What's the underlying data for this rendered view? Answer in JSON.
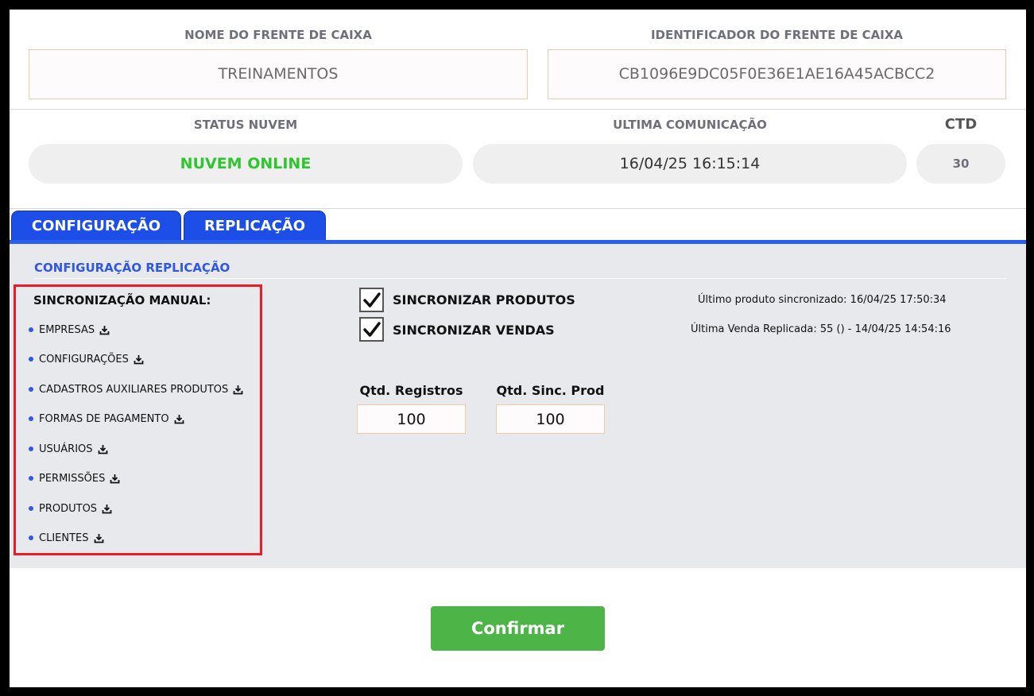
{
  "header": {
    "nome_label": "NOME DO FRENTE DE CAIXA",
    "nome_value": "TREINAMENTOS",
    "id_label": "IDENTIFICADOR DO FRENTE DE CAIXA",
    "id_value": "CB1096E9DC05F0E36E1AE16A45ACBCC2"
  },
  "status": {
    "status_label": "STATUS NUVEM",
    "status_value": "NUVEM ONLINE",
    "status_color": "#2ec52e",
    "ultima_label": "ULTIMA COMUNICAÇÃO",
    "ultima_value": "16/04/25 16:15:14",
    "ctd_label": "CTD",
    "ctd_value": "30"
  },
  "tabs": [
    {
      "label": "CONFIGURAÇÃO",
      "active": false
    },
    {
      "label": "REPLICAÇÃO",
      "active": true
    }
  ],
  "replicacao": {
    "section_title": "CONFIGURAÇÃO REPLICAÇÃO",
    "sync_title": "SINCRONIZAÇÃO MANUAL:",
    "items": [
      {
        "label": "EMPRESAS",
        "icon": "download-icon"
      },
      {
        "label": "CONFIGURAÇÕES",
        "icon": "download-icon"
      },
      {
        "label": "CADASTROS AUXILIARES PRODUTOS",
        "icon": "download-icon"
      },
      {
        "label": "FORMAS DE PAGAMENTO",
        "icon": "download-icon"
      },
      {
        "label": "USUÁRIOS",
        "icon": "download-icon"
      },
      {
        "label": "PERMISSÕES",
        "icon": "download-icon"
      },
      {
        "label": "PRODUTOS",
        "icon": "download-icon"
      },
      {
        "label": "CLIENTES",
        "icon": "download-icon"
      }
    ],
    "sync_produtos": {
      "label": "SINCRONIZAR PRODUTOS",
      "checked": true
    },
    "sync_vendas": {
      "label": "SINCRONIZAR VENDAS",
      "checked": true
    },
    "ultimo_produto": "Último produto sincronizado: 16/04/25 17:50:34",
    "ultima_venda": "Última Venda Replicada: 55 () - 14/04/25 14:54:16",
    "qtd_registros_label": "Qtd. Registros",
    "qtd_registros_value": "100",
    "qtd_sinc_label": "Qtd. Sinc. Prod",
    "qtd_sinc_value": "100"
  },
  "footer": {
    "confirm_label": "Confirmar"
  },
  "colors": {
    "tab_blue": "#1d4ee8",
    "accent_blue": "#2f56e6",
    "confirm_green": "#4db447",
    "highlight_red": "#ee1b24"
  }
}
